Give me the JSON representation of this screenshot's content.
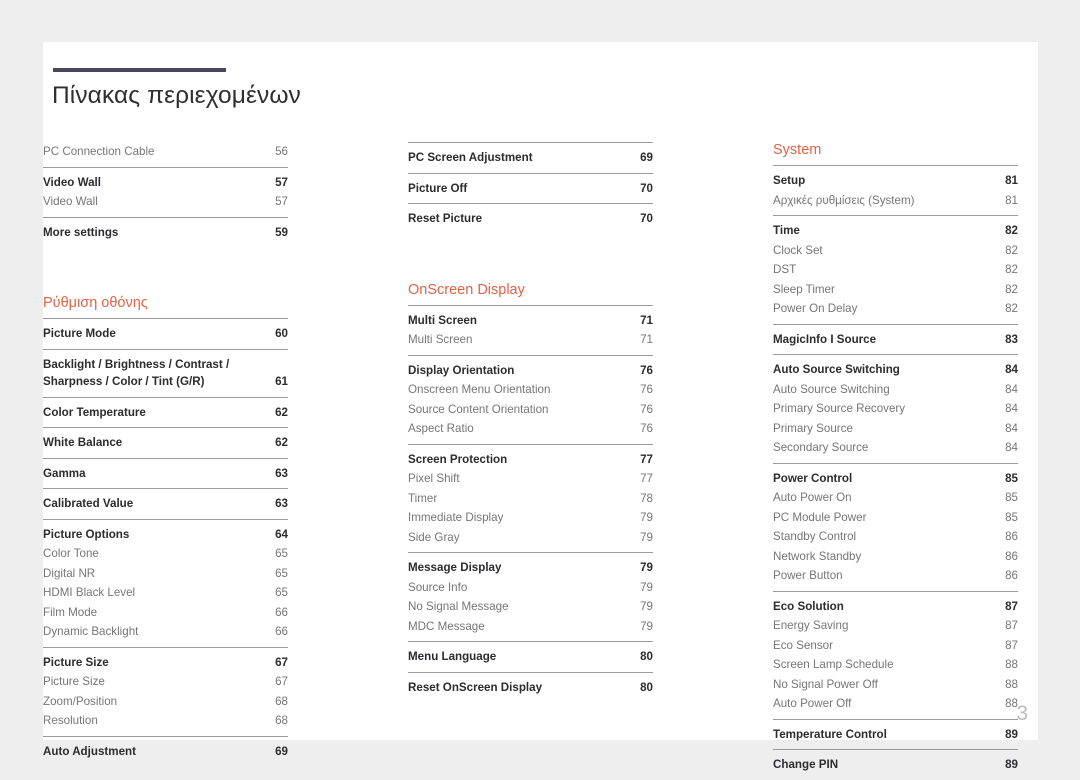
{
  "document": {
    "title": "Πίνακας περιεχομένων",
    "page_number": "3",
    "accent_color": "#de6448",
    "rule_color": "#4b475a",
    "page_bg": "#ffffff",
    "canvas_bg": "#efeeee"
  },
  "columns": [
    {
      "id": "column-1",
      "groups": [
        {
          "rule": false,
          "rows": [
            {
              "style": "sub",
              "label": "PC Connection Cable",
              "page": "56"
            }
          ]
        },
        {
          "rule": true,
          "rows": [
            {
              "style": "main",
              "label": "Video Wall",
              "page": "57"
            },
            {
              "style": "sub",
              "label": "Video Wall",
              "page": "57"
            }
          ]
        },
        {
          "rule": true,
          "rows": [
            {
              "style": "main",
              "label": "More settings",
              "page": "59"
            }
          ]
        }
      ],
      "section": {
        "heading": "Ρύθμιση οθόνης",
        "groups": [
          {
            "rule": true,
            "rows": [
              {
                "style": "main",
                "label": "Picture Mode",
                "page": "60"
              }
            ]
          },
          {
            "rule": true,
            "multiline": true,
            "rows": [
              {
                "style": "main",
                "label": "Backlight / Brightness / Contrast / Sharpness / Color / Tint (G/R)",
                "page": "61",
                "wrap": true
              }
            ]
          },
          {
            "rule": true,
            "rows": [
              {
                "style": "main",
                "label": "Color Temperature",
                "page": "62"
              }
            ]
          },
          {
            "rule": true,
            "rows": [
              {
                "style": "main",
                "label": "White Balance",
                "page": "62"
              }
            ]
          },
          {
            "rule": true,
            "rows": [
              {
                "style": "main",
                "label": "Gamma",
                "page": "63"
              }
            ]
          },
          {
            "rule": true,
            "rows": [
              {
                "style": "main",
                "label": "Calibrated Value",
                "page": "63"
              }
            ]
          },
          {
            "rule": true,
            "rows": [
              {
                "style": "main",
                "label": "Picture Options",
                "page": "64"
              },
              {
                "style": "sub",
                "label": "Color Tone",
                "page": "65"
              },
              {
                "style": "sub",
                "label": "Digital NR",
                "page": "65"
              },
              {
                "style": "sub",
                "label": "HDMI Black Level",
                "page": "65"
              },
              {
                "style": "sub",
                "label": "Film Mode",
                "page": "66"
              },
              {
                "style": "sub",
                "label": "Dynamic Backlight",
                "page": "66"
              }
            ]
          },
          {
            "rule": true,
            "rows": [
              {
                "style": "main",
                "label": "Picture Size",
                "page": "67"
              },
              {
                "style": "sub",
                "label": "Picture Size",
                "page": "67"
              },
              {
                "style": "sub",
                "label": "Zoom/Position",
                "page": "68"
              },
              {
                "style": "sub",
                "label": "Resolution",
                "page": "68"
              }
            ]
          },
          {
            "rule": true,
            "rows": [
              {
                "style": "main",
                "label": "Auto Adjustment",
                "page": "69"
              }
            ]
          }
        ]
      }
    },
    {
      "id": "column-2",
      "groups": [
        {
          "rule": true,
          "rows": [
            {
              "style": "main",
              "label": "PC Screen Adjustment",
              "page": "69"
            }
          ]
        },
        {
          "rule": true,
          "rows": [
            {
              "style": "main",
              "label": "Picture Off",
              "page": "70"
            }
          ]
        },
        {
          "rule": true,
          "rows": [
            {
              "style": "main",
              "label": "Reset Picture",
              "page": "70"
            }
          ]
        }
      ],
      "section": {
        "heading": "OnScreen Display",
        "groups": [
          {
            "rule": true,
            "rows": [
              {
                "style": "main",
                "label": "Multi Screen",
                "page": "71"
              },
              {
                "style": "sub",
                "label": "Multi Screen",
                "page": "71"
              }
            ]
          },
          {
            "rule": true,
            "rows": [
              {
                "style": "main",
                "label": "Display Orientation",
                "page": "76"
              },
              {
                "style": "sub",
                "label": "Onscreen Menu Orientation",
                "page": "76"
              },
              {
                "style": "sub",
                "label": "Source Content Orientation",
                "page": "76"
              },
              {
                "style": "sub",
                "label": "Aspect Ratio",
                "page": "76"
              }
            ]
          },
          {
            "rule": true,
            "rows": [
              {
                "style": "main",
                "label": "Screen Protection",
                "page": "77"
              },
              {
                "style": "sub",
                "label": "Pixel Shift",
                "page": "77"
              },
              {
                "style": "sub",
                "label": "Timer",
                "page": "78"
              },
              {
                "style": "sub",
                "label": "Immediate Display",
                "page": "79"
              },
              {
                "style": "sub",
                "label": "Side Gray",
                "page": "79"
              }
            ]
          },
          {
            "rule": true,
            "rows": [
              {
                "style": "main",
                "label": "Message Display",
                "page": "79"
              },
              {
                "style": "sub",
                "label": "Source Info",
                "page": "79"
              },
              {
                "style": "sub",
                "label": "No Signal Message",
                "page": "79"
              },
              {
                "style": "sub",
                "label": "MDC Message",
                "page": "79"
              }
            ]
          },
          {
            "rule": true,
            "rows": [
              {
                "style": "main",
                "label": "Menu Language",
                "page": "80"
              }
            ]
          },
          {
            "rule": true,
            "rows": [
              {
                "style": "main",
                "label": "Reset OnScreen Display",
                "page": "80"
              }
            ]
          }
        ]
      }
    },
    {
      "id": "column-3",
      "groups": [],
      "section": {
        "heading": "System",
        "groups": [
          {
            "rule": true,
            "rows": [
              {
                "style": "main",
                "label": "Setup",
                "page": "81"
              },
              {
                "style": "sub",
                "label": "Αρχικές ρυθμίσεις (System)",
                "page": "81"
              }
            ]
          },
          {
            "rule": true,
            "rows": [
              {
                "style": "main",
                "label": "Time",
                "page": "82"
              },
              {
                "style": "sub",
                "label": "Clock Set",
                "page": "82"
              },
              {
                "style": "sub",
                "label": "DST",
                "page": "82"
              },
              {
                "style": "sub",
                "label": "Sleep Timer",
                "page": "82"
              },
              {
                "style": "sub",
                "label": "Power On Delay",
                "page": "82"
              }
            ]
          },
          {
            "rule": true,
            "rows": [
              {
                "style": "main",
                "label": "MagicInfo I Source",
                "page": "83"
              }
            ]
          },
          {
            "rule": true,
            "rows": [
              {
                "style": "main",
                "label": "Auto Source Switching",
                "page": "84"
              },
              {
                "style": "sub",
                "label": "Auto Source Switching",
                "page": "84"
              },
              {
                "style": "sub",
                "label": "Primary Source Recovery",
                "page": "84"
              },
              {
                "style": "sub",
                "label": "Primary Source",
                "page": "84"
              },
              {
                "style": "sub",
                "label": "Secondary Source",
                "page": "84"
              }
            ]
          },
          {
            "rule": true,
            "rows": [
              {
                "style": "main",
                "label": "Power Control",
                "page": "85"
              },
              {
                "style": "sub",
                "label": "Auto Power On",
                "page": "85"
              },
              {
                "style": "sub",
                "label": "PC Module Power",
                "page": "85"
              },
              {
                "style": "sub",
                "label": "Standby Control",
                "page": "86"
              },
              {
                "style": "sub",
                "label": "Network Standby",
                "page": "86"
              },
              {
                "style": "sub",
                "label": "Power Button",
                "page": "86"
              }
            ]
          },
          {
            "rule": true,
            "rows": [
              {
                "style": "main",
                "label": "Eco Solution",
                "page": "87"
              },
              {
                "style": "sub",
                "label": "Energy Saving",
                "page": "87"
              },
              {
                "style": "sub",
                "label": "Eco Sensor",
                "page": "87"
              },
              {
                "style": "sub",
                "label": "Screen Lamp Schedule",
                "page": "88"
              },
              {
                "style": "sub",
                "label": "No Signal Power Off",
                "page": "88"
              },
              {
                "style": "sub",
                "label": "Auto Power Off",
                "page": "88"
              }
            ]
          },
          {
            "rule": true,
            "rows": [
              {
                "style": "main",
                "label": "Temperature Control",
                "page": "89"
              }
            ]
          },
          {
            "rule": true,
            "rows": [
              {
                "style": "main",
                "label": "Change PIN",
                "page": "89"
              }
            ]
          }
        ]
      }
    }
  ]
}
